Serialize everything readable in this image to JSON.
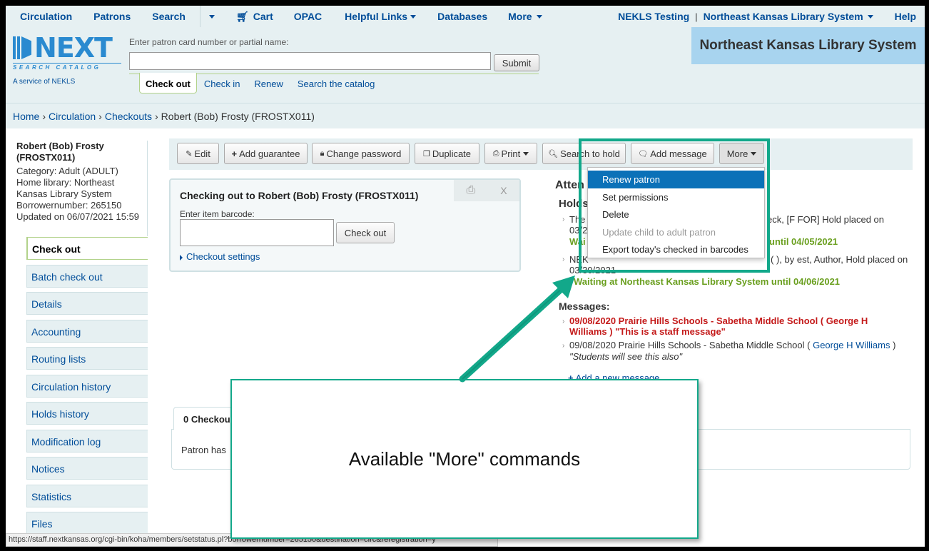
{
  "topnav": {
    "items": [
      "Circulation",
      "Patrons",
      "Search",
      "Cart",
      "OPAC",
      "Helpful Links",
      "Databases",
      "More"
    ],
    "user": "NEKLS Testing",
    "separator": "|",
    "library": "Northeast Kansas Library System",
    "help": "Help"
  },
  "logo": {
    "text": "NEXT",
    "sub": "SEARCH CATALOG",
    "service": "A service of NEKLS"
  },
  "patron_search": {
    "label": "Enter patron card number or partial name:",
    "value": "",
    "submit": "Submit"
  },
  "tabs": [
    "Check out",
    "Check in",
    "Renew",
    "Search the catalog"
  ],
  "org_name": "Northeast Kansas Library System",
  "breadcrumb": {
    "home": "Home",
    "circulation": "Circulation",
    "checkouts": "Checkouts",
    "current": "Robert (Bob) Frosty (FROSTX011)"
  },
  "patron": {
    "name": "Robert (Bob) Frosty",
    "cardnumber": "(FROSTX011)",
    "category": "Category: Adult (ADULT)",
    "home_library_1": "Home library: Northeast",
    "home_library_2": "Kansas Library System",
    "borrowernumber": "Borrowernumber: 265150",
    "updated": "Updated on 06/07/2021 15:59"
  },
  "left_nav": [
    "Check out",
    "Batch check out",
    "Details",
    "Accounting",
    "Routing lists",
    "Circulation history",
    "Holds history",
    "Modification log",
    "Notices",
    "Statistics",
    "Files"
  ],
  "toolbar": {
    "edit": "Edit",
    "add_guarantee": "Add guarantee",
    "change_password": "Change password",
    "duplicate": "Duplicate",
    "print": "Print",
    "search_to_hold": "Search to hold",
    "add_message": "Add message",
    "more": "More"
  },
  "more_menu": [
    "Renew patron",
    "Set permissions",
    "Delete",
    "Update child to adult patron",
    "Export today's checked in barcodes"
  ],
  "checkout": {
    "title": "Checking out to Robert (Bob) Frosty (FROSTX011)",
    "barcode_label": "Enter item barcode:",
    "button": "Check out",
    "settings": "Checkout settings"
  },
  "attention": {
    "heading": "Atten",
    "holds_heading": "Holds",
    "hold1_link": "The",
    "hold1_rest": "eck, [F FOR] Hold placed on",
    "hold1_date": "03/2",
    "hold1_status_a": "Wai",
    "hold1_status_b": "until 04/05/2021",
    "hold2_link": "NEK",
    "hold2_rest": "(           ), by   est, Author, Hold placed on",
    "hold2_date": "03/30/2021",
    "hold2_status": "Waiting at Northeast Kansas Library System until 04/06/2021",
    "messages_heading": "Messages:",
    "msg1_line1": "09/08/2020 Prairie Hills Schools - Sabetha Middle School ( George H",
    "msg1_line2": "Williams ) \"This is a staff message\"",
    "msg2_prefix": "09/08/2020 Prairie Hills Schools - Sabetha Middle School (",
    "msg2_name": "George H Williams",
    "msg2_suffix": ")",
    "msg2_text": "\"Students will see this also\"",
    "add_message": "Add a new message"
  },
  "checkouts_tab": {
    "label": "0 Checkou",
    "text": "Patron has"
  },
  "status_url": "https://staff.nextkansas.org/cgi-bin/koha/members/setstatus.pl?borrowernumber=265150&destination=circ&reregistration=y",
  "annotation": "Available \"More\" commands",
  "colors": {
    "nav_bg": "#e6f0f2",
    "link": "#004d99",
    "highlight": "#12a88a",
    "menu_selected": "#0b71b8"
  }
}
